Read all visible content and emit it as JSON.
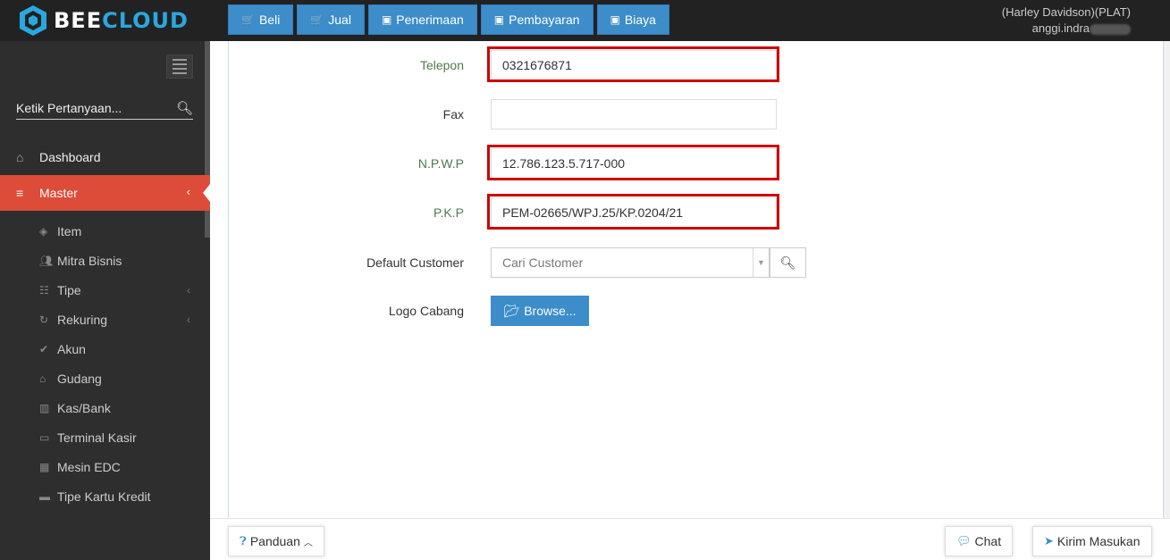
{
  "brand": {
    "part1": "BEE",
    "part2": "CLOUD"
  },
  "topnav": [
    {
      "label": "Beli",
      "icon": "cart-icon"
    },
    {
      "label": "Jual",
      "icon": "cart-icon"
    },
    {
      "label": "Penerimaan",
      "icon": "money-icon"
    },
    {
      "label": "Pembayaran",
      "icon": "money-icon"
    },
    {
      "label": "Biaya",
      "icon": "money-icon"
    }
  ],
  "user": {
    "company": "(Harley Davidson)(PLAT)",
    "name": "anggi.indra"
  },
  "sidebar": {
    "search_placeholder": "Ketik Pertanyaan...",
    "items": [
      {
        "label": "Dashboard",
        "icon": "home-icon"
      },
      {
        "label": "Master",
        "icon": "database-icon",
        "active": true
      }
    ],
    "subitems": [
      {
        "label": "Item",
        "icon": "cube-icon"
      },
      {
        "label": "Mitra Bisnis",
        "icon": "users-icon"
      },
      {
        "label": "Tipe",
        "icon": "sitemap-icon",
        "chevron": true
      },
      {
        "label": "Rekuring",
        "icon": "refresh-icon",
        "chevron": true
      },
      {
        "label": "Akun",
        "icon": "check-icon"
      },
      {
        "label": "Gudang",
        "icon": "home-icon"
      },
      {
        "label": "Kas/Bank",
        "icon": "bank-icon"
      },
      {
        "label": "Terminal Kasir",
        "icon": "monitor-icon"
      },
      {
        "label": "Mesin EDC",
        "icon": "calculator-icon"
      },
      {
        "label": "Tipe Kartu Kredit",
        "icon": "credit-card-icon"
      }
    ]
  },
  "form": {
    "telepon": {
      "label": "Telepon",
      "value": "0321676871"
    },
    "fax": {
      "label": "Fax",
      "value": ""
    },
    "npwp": {
      "label": "N.P.W.P",
      "value": "12.786.123.5.717-000"
    },
    "pkp": {
      "label": "P.K.P",
      "value": "PEM-02665/WPJ.25/KP.0204/21"
    },
    "default_customer": {
      "label": "Default Customer",
      "placeholder": "Cari Customer"
    },
    "logo": {
      "label": "Logo Cabang",
      "button": "Browse..."
    }
  },
  "footer": {
    "panduan": "Panduan",
    "chat": "Chat",
    "kirim": "Kirim Masukan"
  },
  "colors": {
    "accent": "#3c8dc9",
    "active": "#dd4b39",
    "highlight": "#cc0000"
  }
}
